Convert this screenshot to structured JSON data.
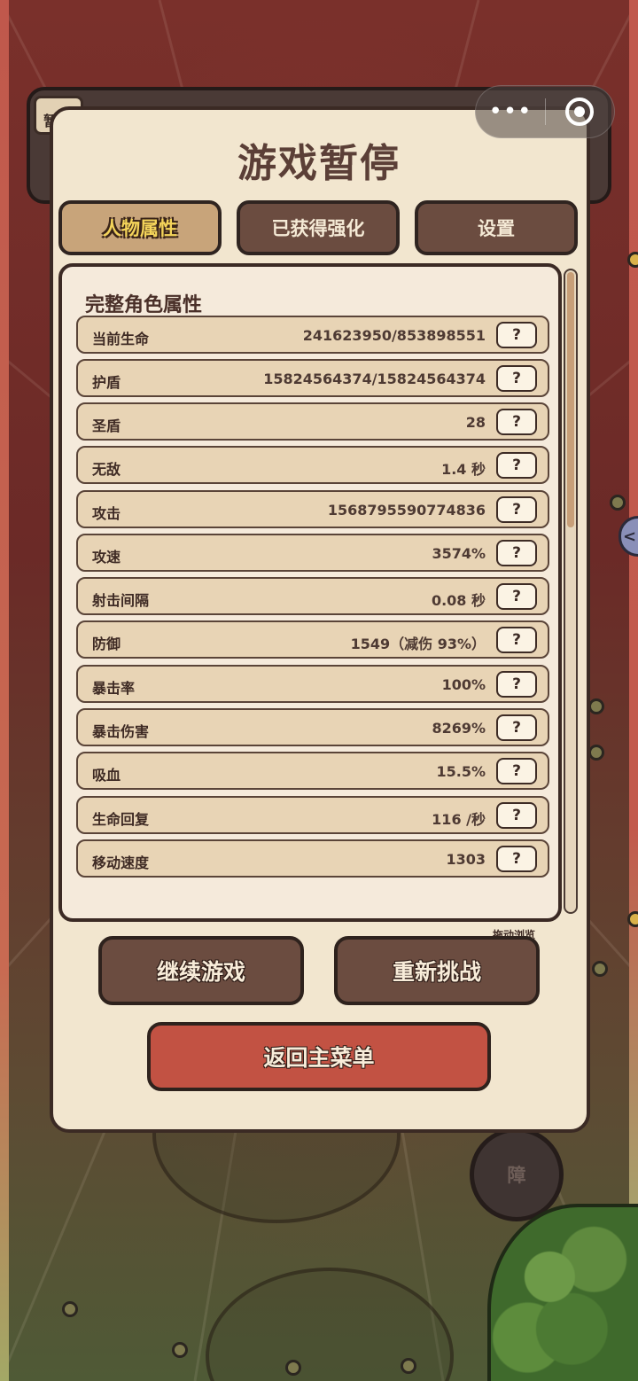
{
  "background": {
    "hud_tab_char": "暂",
    "obstacle_button": "障",
    "side_arrow": "<"
  },
  "capsule": {
    "more_icon": "•••",
    "close_icon": "target-circle"
  },
  "pause_menu": {
    "title": "游戏暂停",
    "tabs": [
      {
        "label": "人物属性",
        "active": true
      },
      {
        "label": "已获得强化",
        "active": false
      },
      {
        "label": "设置",
        "active": false
      }
    ],
    "section_title": "完整角色属性",
    "stats": [
      {
        "label": "当前生命",
        "value": "241623950/853898551"
      },
      {
        "label": "护盾",
        "value": "15824564374/15824564374"
      },
      {
        "label": "圣盾",
        "value": "28"
      },
      {
        "label": "无敌",
        "value": "1.4 秒"
      },
      {
        "label": "攻击",
        "value": "1568795590774836"
      },
      {
        "label": "攻速",
        "value": "3574%"
      },
      {
        "label": "射击间隔",
        "value": "0.08 秒"
      },
      {
        "label": "防御",
        "value": "1549（减伤 93%）"
      },
      {
        "label": "暴击率",
        "value": "100%"
      },
      {
        "label": "暴击伤害",
        "value": "8269%"
      },
      {
        "label": "吸血",
        "value": "15.5%"
      },
      {
        "label": "生命回复",
        "value": "116 /秒"
      },
      {
        "label": "移动速度",
        "value": "1303"
      }
    ],
    "help_label": "?",
    "scroll_hint": "拖动浏览",
    "buttons": {
      "continue": "继续游戏",
      "retry": "重新挑战",
      "main_menu": "返回主菜单"
    }
  },
  "colors": {
    "panel_bg": "#f2e6cf",
    "tab_active": "#c8a47a",
    "tab_inactive": "#6b4c40",
    "main_menu_button": "#c25243"
  }
}
